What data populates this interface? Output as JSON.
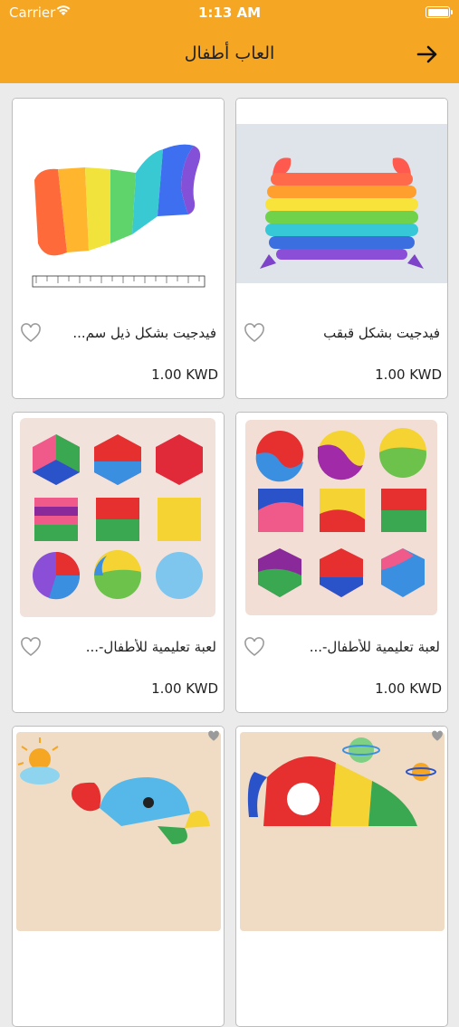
{
  "status_bar": {
    "carrier": "Carrier",
    "time": "1:13 AM"
  },
  "header": {
    "title": "العاب أطفال"
  },
  "products": [
    {
      "name": "فيدجيت بشكل قبقب",
      "price": "1.00 KWD"
    },
    {
      "name": "فيدجيت بشكل ذيل سم...",
      "price": "1.00 KWD"
    },
    {
      "name": "لعبة تعليمية للأطفال-...",
      "price": "1.00 KWD"
    },
    {
      "name": "لعبة تعليمية للأطفال-...",
      "price": "1.00 KWD"
    },
    {
      "name": "",
      "price": ""
    },
    {
      "name": "",
      "price": ""
    }
  ],
  "colors": {
    "header": "#f5a623",
    "background": "#ebebeb"
  }
}
